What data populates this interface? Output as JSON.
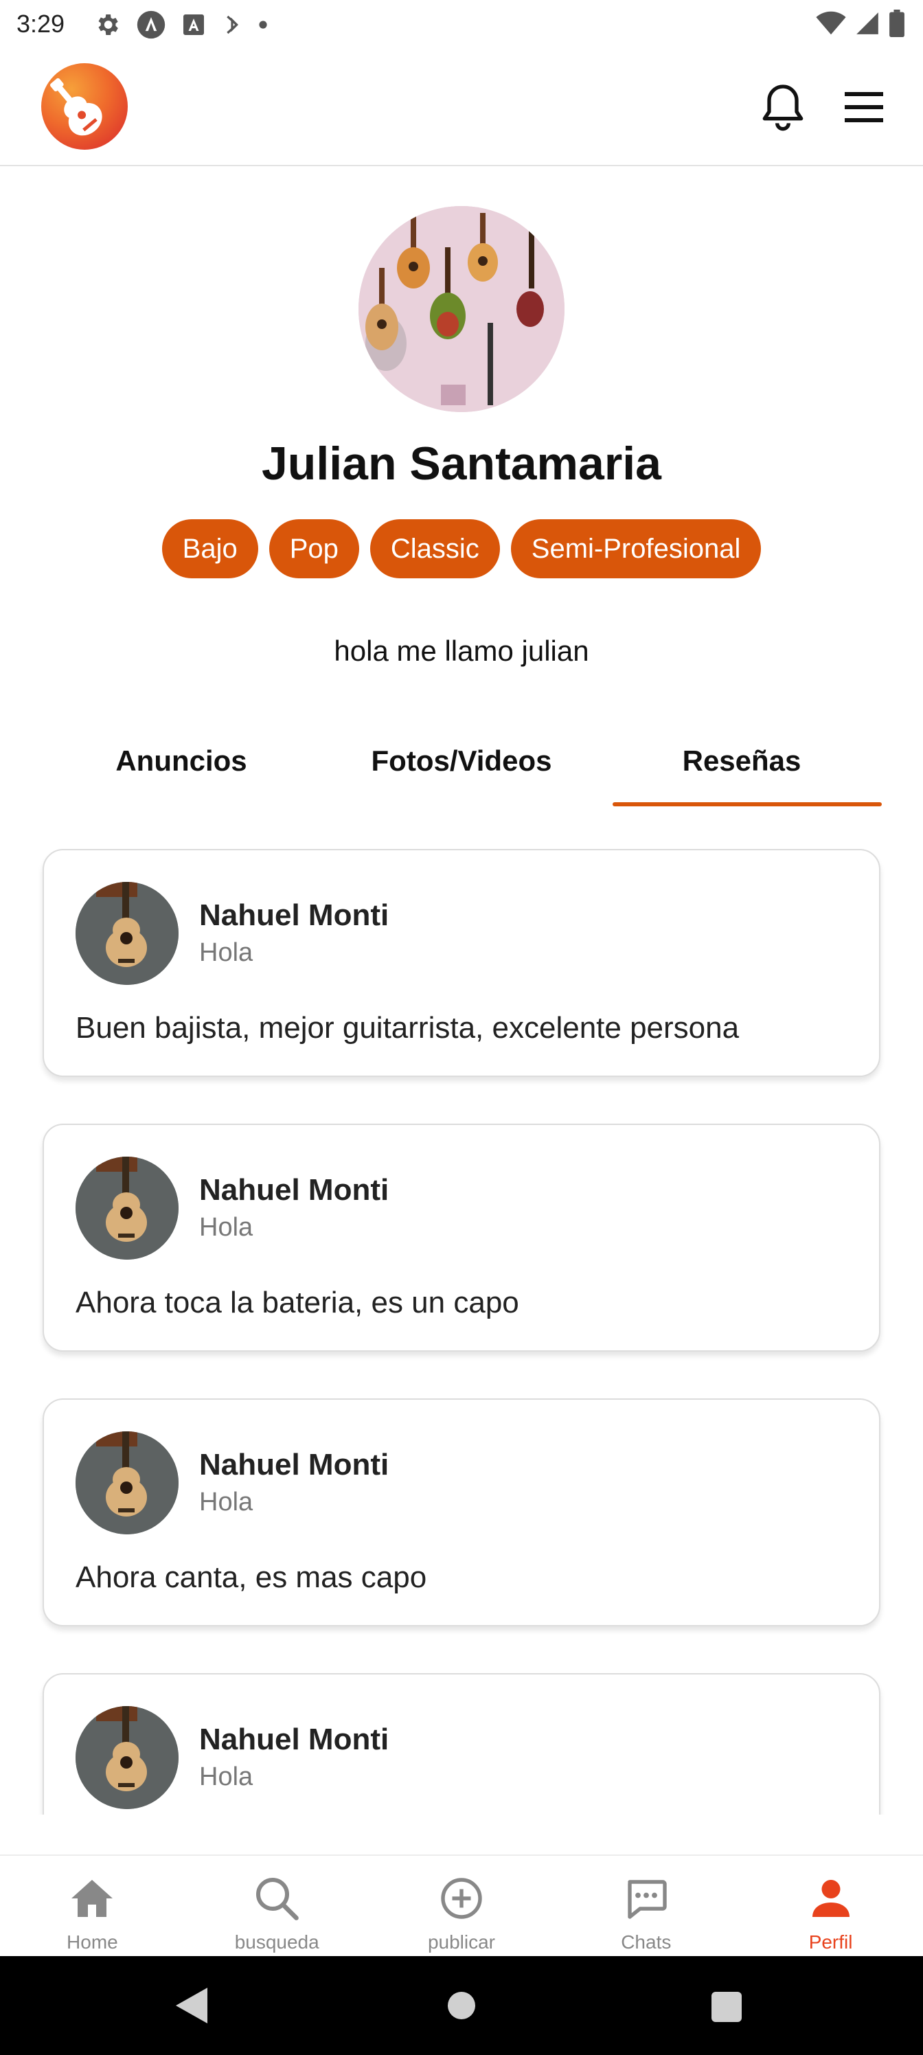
{
  "status_bar": {
    "time": "3:29",
    "icons": [
      "gear-icon",
      "a-badge-icon",
      "a-box-icon",
      "sync-icon",
      "dot-icon",
      "wifi-icon",
      "signal-icon",
      "battery-icon"
    ]
  },
  "app_bar": {
    "logo_icon": "guitar-logo-icon",
    "actions": [
      "bell-icon",
      "menu-icon"
    ]
  },
  "profile": {
    "name": "Julian Santamaria",
    "tags": [
      "Bajo",
      "Pop",
      "Classic",
      "Semi-Profesional"
    ],
    "bio": "hola me llamo julian"
  },
  "tabs": [
    {
      "label": "Anuncios",
      "active": false
    },
    {
      "label": "Fotos/Videos",
      "active": false
    },
    {
      "label": "Reseñas",
      "active": true
    }
  ],
  "reviews": [
    {
      "name": "Nahuel Monti",
      "subtitle": "Hola",
      "text": "Buen bajista, mejor guitarrista, excelente persona"
    },
    {
      "name": "Nahuel Monti",
      "subtitle": "Hola",
      "text": "Ahora toca la bateria, es un capo"
    },
    {
      "name": "Nahuel Monti",
      "subtitle": "Hola",
      "text": "Ahora canta, es mas capo"
    },
    {
      "name": "Nahuel Monti",
      "subtitle": "Hola",
      "text": ""
    }
  ],
  "bottom_nav": [
    {
      "label": "Home",
      "icon": "home-icon",
      "active": false
    },
    {
      "label": "busqueda",
      "icon": "search-icon",
      "active": false
    },
    {
      "label": "publicar",
      "icon": "add-circle-icon",
      "active": false
    },
    {
      "label": "Chats",
      "icon": "chat-icon",
      "active": false
    },
    {
      "label": "Perfil",
      "icon": "person-icon",
      "active": true
    }
  ],
  "colors": {
    "accent": "#d9560a",
    "nav_active": "#e8421c",
    "nav_inactive": "#888888"
  }
}
